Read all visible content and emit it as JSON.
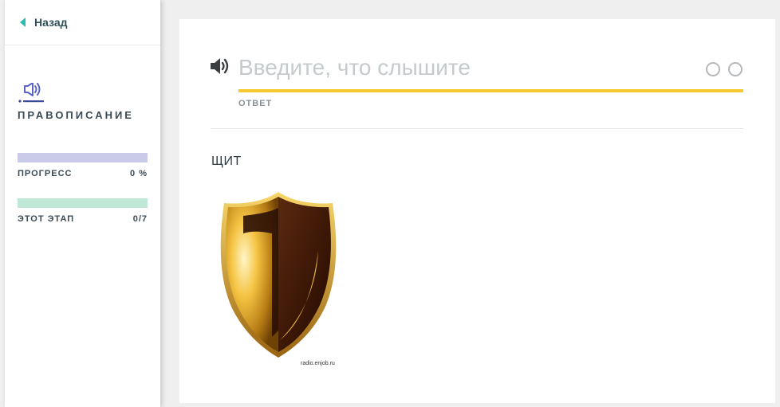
{
  "sidebar": {
    "back_label": "Назад",
    "mode_icon": "speaker-icon",
    "mode_title": "ПРАВОПИСАНИЕ",
    "progress": {
      "label": "ПРОГРЕСС",
      "value": "0 %",
      "fraction": 0
    },
    "stage": {
      "label": "ЭТОТ ЭТАП",
      "value": "0/7",
      "fraction": 0
    }
  },
  "main": {
    "input": {
      "placeholder": "Введите, что слышите",
      "value": ""
    },
    "input_label": "ОТВЕТ",
    "hint_word": "ЩИТ",
    "image_icon": "shield-image",
    "watermark": "radio.enjob.ru"
  },
  "colors": {
    "accent_teal": "#2bbdb0",
    "underline_yellow": "#f8c82f",
    "progress_bar": "#c9cbe8",
    "stage_bar": "#bfe8d6"
  }
}
